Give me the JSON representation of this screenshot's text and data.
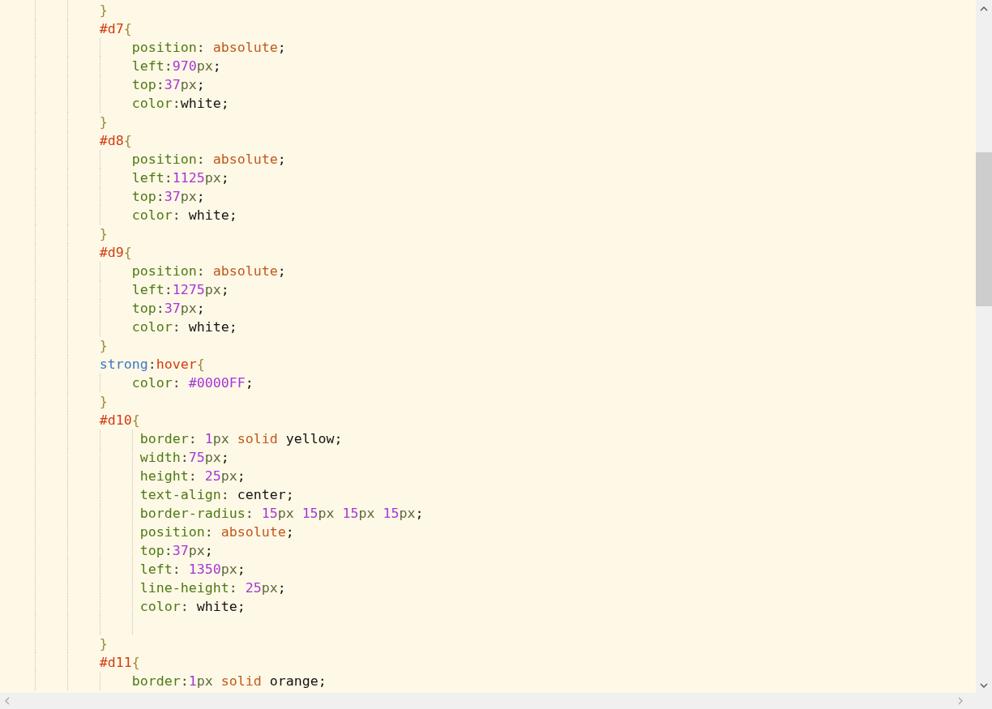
{
  "editor": {
    "lines": [
      {
        "kind": "rule",
        "tokens": [
          {
            "kind": "brace",
            "text": "}"
          }
        ]
      },
      {
        "kind": "rule",
        "tokens": [
          {
            "kind": "selector",
            "text": "#d7"
          },
          {
            "kind": "brace",
            "text": "{"
          }
        ]
      },
      {
        "kind": "decl",
        "tokens": [
          {
            "kind": "property",
            "text": "position"
          },
          {
            "kind": "colon",
            "text": ": "
          },
          {
            "kind": "keyword",
            "text": "absolute"
          },
          {
            "kind": "punct",
            "text": ";"
          }
        ]
      },
      {
        "kind": "decl",
        "tokens": [
          {
            "kind": "property",
            "text": "left"
          },
          {
            "kind": "colon",
            "text": ":"
          },
          {
            "kind": "number",
            "text": "970"
          },
          {
            "kind": "unit",
            "text": "px"
          },
          {
            "kind": "punct",
            "text": ";"
          }
        ]
      },
      {
        "kind": "decl",
        "tokens": [
          {
            "kind": "property",
            "text": "top"
          },
          {
            "kind": "colon",
            "text": ":"
          },
          {
            "kind": "number",
            "text": "37"
          },
          {
            "kind": "unit",
            "text": "px"
          },
          {
            "kind": "punct",
            "text": ";"
          }
        ]
      },
      {
        "kind": "decl",
        "tokens": [
          {
            "kind": "property",
            "text": "color"
          },
          {
            "kind": "colon",
            "text": ":"
          },
          {
            "kind": "plain",
            "text": "white;"
          }
        ]
      },
      {
        "kind": "rule",
        "tokens": [
          {
            "kind": "brace",
            "text": "}"
          }
        ]
      },
      {
        "kind": "rule",
        "tokens": [
          {
            "kind": "selector",
            "text": "#d8"
          },
          {
            "kind": "brace",
            "text": "{"
          }
        ]
      },
      {
        "kind": "decl",
        "tokens": [
          {
            "kind": "property",
            "text": "position"
          },
          {
            "kind": "colon",
            "text": ": "
          },
          {
            "kind": "keyword",
            "text": "absolute"
          },
          {
            "kind": "punct",
            "text": ";"
          }
        ]
      },
      {
        "kind": "decl",
        "tokens": [
          {
            "kind": "property",
            "text": "left"
          },
          {
            "kind": "colon",
            "text": ":"
          },
          {
            "kind": "number",
            "text": "1125"
          },
          {
            "kind": "unit",
            "text": "px"
          },
          {
            "kind": "punct",
            "text": ";"
          }
        ]
      },
      {
        "kind": "decl",
        "tokens": [
          {
            "kind": "property",
            "text": "top"
          },
          {
            "kind": "colon",
            "text": ":"
          },
          {
            "kind": "number",
            "text": "37"
          },
          {
            "kind": "unit",
            "text": "px"
          },
          {
            "kind": "punct",
            "text": ";"
          }
        ]
      },
      {
        "kind": "decl",
        "tokens": [
          {
            "kind": "property",
            "text": "color"
          },
          {
            "kind": "colon",
            "text": ": "
          },
          {
            "kind": "plain",
            "text": "white;"
          }
        ]
      },
      {
        "kind": "rule",
        "tokens": [
          {
            "kind": "brace",
            "text": "}"
          }
        ]
      },
      {
        "kind": "rule",
        "tokens": [
          {
            "kind": "selector",
            "text": "#d9"
          },
          {
            "kind": "brace",
            "text": "{"
          }
        ]
      },
      {
        "kind": "decl",
        "tokens": [
          {
            "kind": "property",
            "text": "position"
          },
          {
            "kind": "colon",
            "text": ": "
          },
          {
            "kind": "keyword",
            "text": "absolute"
          },
          {
            "kind": "punct",
            "text": ";"
          }
        ]
      },
      {
        "kind": "decl",
        "tokens": [
          {
            "kind": "property",
            "text": "left"
          },
          {
            "kind": "colon",
            "text": ":"
          },
          {
            "kind": "number",
            "text": "1275"
          },
          {
            "kind": "unit",
            "text": "px"
          },
          {
            "kind": "punct",
            "text": ";"
          }
        ]
      },
      {
        "kind": "decl",
        "tokens": [
          {
            "kind": "property",
            "text": "top"
          },
          {
            "kind": "colon",
            "text": ":"
          },
          {
            "kind": "number",
            "text": "37"
          },
          {
            "kind": "unit",
            "text": "px"
          },
          {
            "kind": "punct",
            "text": ";"
          }
        ]
      },
      {
        "kind": "decl",
        "tokens": [
          {
            "kind": "property",
            "text": "color"
          },
          {
            "kind": "colon",
            "text": ": "
          },
          {
            "kind": "plain",
            "text": "white;"
          }
        ]
      },
      {
        "kind": "rule",
        "tokens": [
          {
            "kind": "brace",
            "text": "}"
          }
        ]
      },
      {
        "kind": "rule",
        "tokens": [
          {
            "kind": "tag",
            "text": "strong"
          },
          {
            "kind": "colon",
            "text": ":"
          },
          {
            "kind": "selector",
            "text": "hover"
          },
          {
            "kind": "brace",
            "text": "{"
          }
        ]
      },
      {
        "kind": "decl",
        "tokens": [
          {
            "kind": "property",
            "text": "color"
          },
          {
            "kind": "colon",
            "text": ": "
          },
          {
            "kind": "number",
            "text": "#0000FF"
          },
          {
            "kind": "punct",
            "text": ";"
          }
        ]
      },
      {
        "kind": "rule",
        "tokens": [
          {
            "kind": "brace",
            "text": "}"
          }
        ]
      },
      {
        "kind": "rule",
        "tokens": [
          {
            "kind": "selector",
            "text": "#d10"
          },
          {
            "kind": "brace",
            "text": "{"
          }
        ]
      },
      {
        "kind": "deep",
        "tokens": [
          {
            "kind": "property",
            "text": "border"
          },
          {
            "kind": "colon",
            "text": ": "
          },
          {
            "kind": "number",
            "text": "1"
          },
          {
            "kind": "unit",
            "text": "px "
          },
          {
            "kind": "keyword",
            "text": "solid"
          },
          {
            "kind": "plain",
            "text": " yellow;"
          }
        ]
      },
      {
        "kind": "deep",
        "tokens": [
          {
            "kind": "property",
            "text": "width"
          },
          {
            "kind": "colon",
            "text": ":"
          },
          {
            "kind": "number",
            "text": "75"
          },
          {
            "kind": "unit",
            "text": "px"
          },
          {
            "kind": "punct",
            "text": ";"
          }
        ]
      },
      {
        "kind": "deep",
        "tokens": [
          {
            "kind": "property",
            "text": "height"
          },
          {
            "kind": "colon",
            "text": ": "
          },
          {
            "kind": "number",
            "text": "25"
          },
          {
            "kind": "unit",
            "text": "px"
          },
          {
            "kind": "punct",
            "text": ";"
          }
        ]
      },
      {
        "kind": "deep",
        "tokens": [
          {
            "kind": "property",
            "text": "text-align"
          },
          {
            "kind": "colon",
            "text": ": "
          },
          {
            "kind": "plain",
            "text": "center;"
          }
        ]
      },
      {
        "kind": "deep",
        "tokens": [
          {
            "kind": "property",
            "text": "border-radius"
          },
          {
            "kind": "colon",
            "text": ": "
          },
          {
            "kind": "number",
            "text": "15"
          },
          {
            "kind": "unit",
            "text": "px "
          },
          {
            "kind": "number",
            "text": "15"
          },
          {
            "kind": "unit",
            "text": "px "
          },
          {
            "kind": "number",
            "text": "15"
          },
          {
            "kind": "unit",
            "text": "px "
          },
          {
            "kind": "number",
            "text": "15"
          },
          {
            "kind": "unit",
            "text": "px"
          },
          {
            "kind": "punct",
            "text": ";"
          }
        ]
      },
      {
        "kind": "deep",
        "tokens": [
          {
            "kind": "property",
            "text": "position"
          },
          {
            "kind": "colon",
            "text": ": "
          },
          {
            "kind": "keyword",
            "text": "absolute"
          },
          {
            "kind": "punct",
            "text": ";"
          }
        ]
      },
      {
        "kind": "deep",
        "tokens": [
          {
            "kind": "property",
            "text": "top"
          },
          {
            "kind": "colon",
            "text": ":"
          },
          {
            "kind": "number",
            "text": "37"
          },
          {
            "kind": "unit",
            "text": "px"
          },
          {
            "kind": "punct",
            "text": ";"
          }
        ]
      },
      {
        "kind": "deep",
        "tokens": [
          {
            "kind": "property",
            "text": "left"
          },
          {
            "kind": "colon",
            "text": ": "
          },
          {
            "kind": "number",
            "text": "1350"
          },
          {
            "kind": "unit",
            "text": "px"
          },
          {
            "kind": "punct",
            "text": ";"
          }
        ]
      },
      {
        "kind": "deep",
        "tokens": [
          {
            "kind": "property",
            "text": "line-height"
          },
          {
            "kind": "colon",
            "text": ": "
          },
          {
            "kind": "number",
            "text": "25"
          },
          {
            "kind": "unit",
            "text": "px"
          },
          {
            "kind": "punct",
            "text": ";"
          }
        ]
      },
      {
        "kind": "deep",
        "tokens": [
          {
            "kind": "property",
            "text": "color"
          },
          {
            "kind": "colon",
            "text": ": "
          },
          {
            "kind": "plain",
            "text": "white;"
          }
        ]
      },
      {
        "kind": "deep"
      },
      {
        "kind": "rule",
        "tokens": [
          {
            "kind": "brace",
            "text": "}"
          }
        ]
      },
      {
        "kind": "rule",
        "tokens": [
          {
            "kind": "selector",
            "text": "#d11"
          },
          {
            "kind": "brace",
            "text": "{"
          }
        ]
      },
      {
        "kind": "decl",
        "tokens": [
          {
            "kind": "property",
            "text": "border"
          },
          {
            "kind": "colon",
            "text": ":"
          },
          {
            "kind": "number",
            "text": "1"
          },
          {
            "kind": "unit",
            "text": "px "
          },
          {
            "kind": "keyword",
            "text": "solid"
          },
          {
            "kind": "plain",
            "text": " orange;"
          }
        ]
      }
    ]
  }
}
